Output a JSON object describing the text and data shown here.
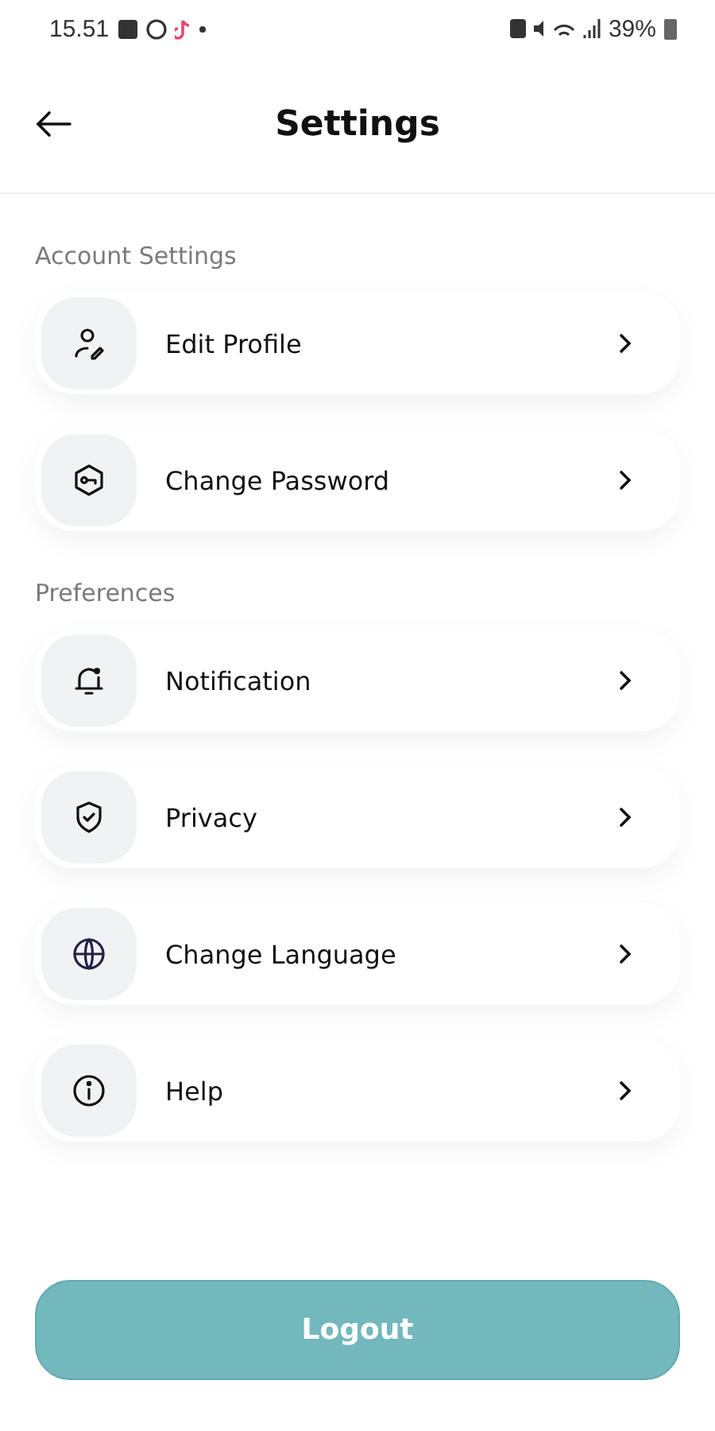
{
  "status_bar": {
    "time": "15.51",
    "battery": "39%"
  },
  "header": {
    "title": "Settings"
  },
  "sections": [
    {
      "title": "Account Settings",
      "items": [
        {
          "label": "Edit Profile"
        },
        {
          "label": "Change Password"
        }
      ]
    },
    {
      "title": "Preferences",
      "items": [
        {
          "label": "Notification"
        },
        {
          "label": "Privacy"
        },
        {
          "label": "Change Language"
        },
        {
          "label": "Help"
        }
      ]
    }
  ],
  "logout_button": {
    "label": "Logout"
  }
}
